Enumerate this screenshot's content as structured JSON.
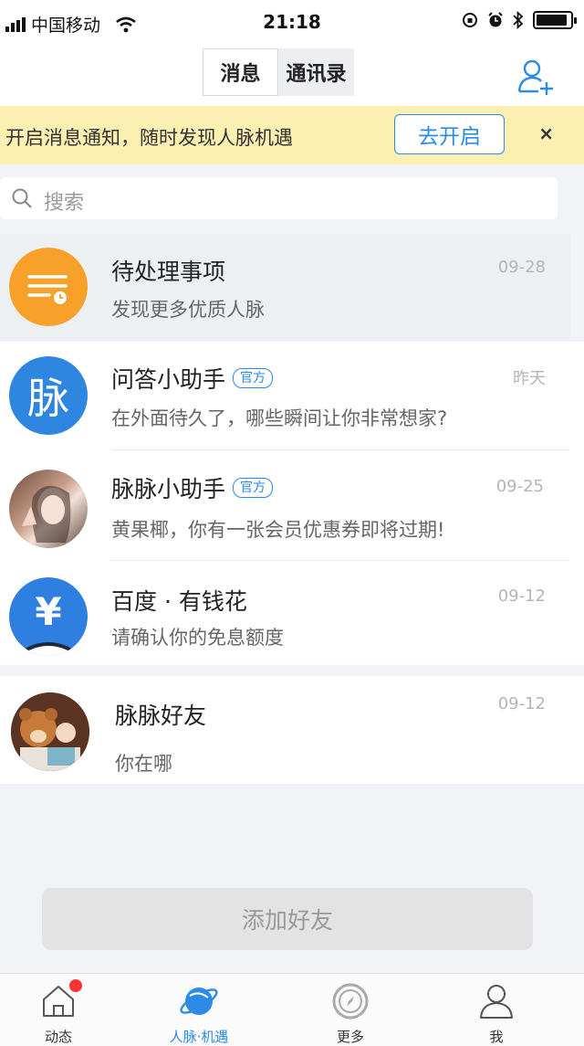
{
  "status_bar": {
    "carrier": "中国移动",
    "time": "21:18"
  },
  "nav": {
    "tabs": [
      {
        "label": "消息",
        "active": true
      },
      {
        "label": "通讯录",
        "active": false
      }
    ],
    "add_contact_icon": "add-contact-icon"
  },
  "banner": {
    "text": "开启消息通知，随时发现人脉机遇",
    "button": "去开启",
    "close": "×"
  },
  "search": {
    "placeholder": "搜索"
  },
  "conversations": [
    {
      "title": "待处理事项",
      "subtitle": "发现更多优质人脉",
      "date": "09-28",
      "badge": ""
    },
    {
      "title": "问答小助手",
      "subtitle": "在外面待久了，哪些瞬间让你非常想家?",
      "date": "昨天",
      "badge": "官方"
    },
    {
      "title": "脉脉小助手",
      "subtitle": "黄果椰，你有一张会员优惠券即将过期!",
      "date": "09-25",
      "badge": "官方"
    },
    {
      "title": "百度 · 有钱花",
      "subtitle": "请确认你的免息额度",
      "date": "09-12",
      "badge": ""
    },
    {
      "title": "脉脉好友",
      "subtitle": "你在哪",
      "date": "09-12",
      "badge": ""
    }
  ],
  "avatar_glyph": "脉",
  "yen_glyph": "¥",
  "add_friend": "添加好友",
  "tabbar": [
    {
      "label": "动态",
      "icon": "home-icon"
    },
    {
      "label": "人脉·机遇",
      "icon": "planet-icon"
    },
    {
      "label": "更多",
      "icon": "compass-icon"
    },
    {
      "label": "我",
      "icon": "person-icon"
    }
  ],
  "colors": {
    "accent": "#2b8be6",
    "banner_bg": "#fbf0b1",
    "pending_orange": "#f7a12a"
  }
}
